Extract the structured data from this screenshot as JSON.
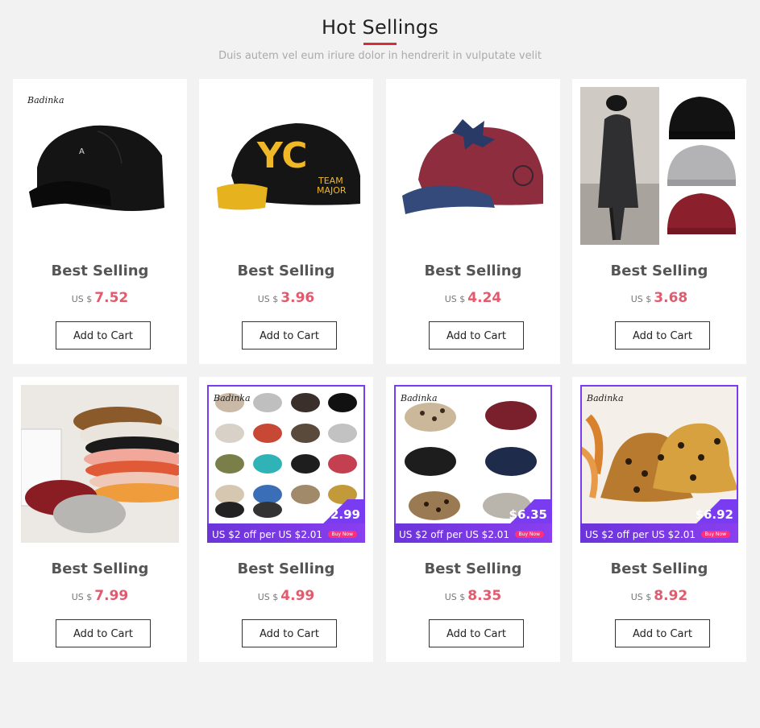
{
  "section": {
    "title": "Hot Sellings",
    "subtitle": "Duis autem vel eum iriure dolor in hendrerit in vulputate velit"
  },
  "colors": {
    "accent": "#d72c3a",
    "price": "#e35a6d",
    "promo": "#7a3cf0"
  },
  "products": [
    {
      "name": "Best Selling",
      "currency": "US $",
      "price": "7.52",
      "button": "Add to Cart",
      "image": "black-baseball-cap",
      "brand": "Badinka"
    },
    {
      "name": "Best Selling",
      "currency": "US $",
      "price": "3.96",
      "button": "Add to Cart",
      "image": "ny-team-major-cap"
    },
    {
      "name": "Best Selling",
      "currency": "US $",
      "price": "4.24",
      "button": "Add to Cart",
      "image": "red-denim-cap"
    },
    {
      "name": "Best Selling",
      "currency": "US $",
      "price": "3.68",
      "button": "Add to Cart",
      "image": "beanie-collage"
    },
    {
      "name": "Best Selling",
      "currency": "US $",
      "price": "7.99",
      "button": "Add to Cart",
      "image": "beret-stack"
    },
    {
      "name": "Best Selling",
      "currency": "US $",
      "price": "4.99",
      "button": "Add to Cart",
      "image": "mesh-caps-grid",
      "promo_price": "$2.99",
      "promo_text": "US $2 off per US $2.01",
      "promo_button": "Buy Now",
      "brand": "Badinka"
    },
    {
      "name": "Best Selling",
      "currency": "US $",
      "price": "8.35",
      "button": "Add to Cart",
      "image": "leopard-caps-grid",
      "promo_price": "$6.35",
      "promo_text": "US $2 off per US $2.01",
      "promo_button": "Buy Now",
      "brand": "Badinka"
    },
    {
      "name": "Best Selling",
      "currency": "US $",
      "price": "8.92",
      "button": "Add to Cart",
      "image": "leopard-bucket-hats",
      "promo_price": "$6.92",
      "promo_text": "US $2 off per US $2.01",
      "promo_button": "Buy Now",
      "brand": "Badinka"
    }
  ]
}
